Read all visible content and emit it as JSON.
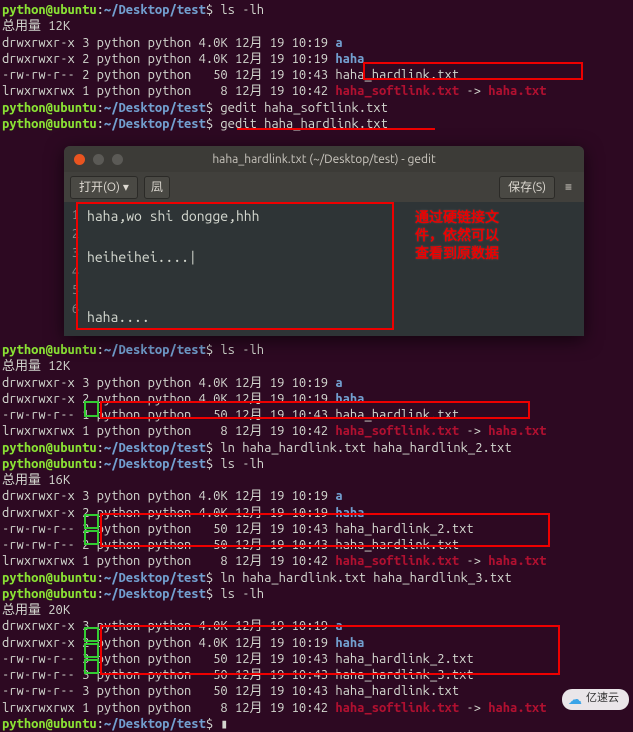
{
  "prompt": {
    "user": "python@ubuntu",
    "path": "~/Desktop/test",
    "sep": ":",
    "sym": "$"
  },
  "cmds": {
    "ls": "ls -lh",
    "gedit_soft": "gedit haha_softlink.txt",
    "gedit_hard": "gedit haha_hardlink.txt",
    "ln2": "ln haha_hardlink.txt haha_hardlink_2.txt",
    "ln3": "ln haha_hardlink.txt haha_hardlink_3.txt"
  },
  "totals": {
    "t12": "总用量 12K",
    "t16": "总用量 16K",
    "t20": "总用量 20K"
  },
  "rows": {
    "a": "drwxrwxr-x 3 python python 4.0K 12月 19 10:19 ",
    "haha": "drwxrwxr-x 2 python python 4.0K 12月 19 10:19 ",
    "hard1_2": "-rw-rw-r-- 2 python python   50 12月 19 10:43 haha_hardlink.txt",
    "hard1_1": "-rw-rw-r-- 1 python python   50 12月 19 10:43 ",
    "hard1_1_name": "haha_hardlink.txt",
    "soft_pre": "lrwxrwxrwx 1 python python    8 12月 19 10:42 ",
    "soft_name": "haha_softlink.txt",
    "soft_arrow": " -> ",
    "soft_target": "haha.txt",
    "hard2_2": "-rw-rw-r-- 2 python python   50 12月 19 10:43 haha_hardlink_2.txt",
    "hard2_2b": "-rw-rw-r-- 2 python python   50 12月 19 10:43 haha_hardlink.txt",
    "hard3_3a": "-rw-rw-r-- 3 python python   50 12月 19 10:43 haha_hardlink_2.txt",
    "hard3_3b": "-rw-rw-r-- 3 python python   50 12月 19 10:43 haha_hardlink_3.txt",
    "hard3_3c": "-rw-rw-r-- 3 python python   50 12月 19 10:43 haha_hardlink.txt",
    "dir_a": "a",
    "dir_haha": "haha"
  },
  "gedit": {
    "title": "haha_hardlink.txt (~/Desktop/test) - gedit",
    "open": "打开(O)",
    "save": "保存(S)",
    "lines": [
      "haha,wo shi  dongge,hhh",
      "",
      "heiheihei....|",
      "",
      "",
      "haha...."
    ]
  },
  "annotation": {
    "l1": "通过硬链接文",
    "l2": "件，依然可以",
    "l3": "查看到原数据"
  },
  "watermark": "亿速云"
}
